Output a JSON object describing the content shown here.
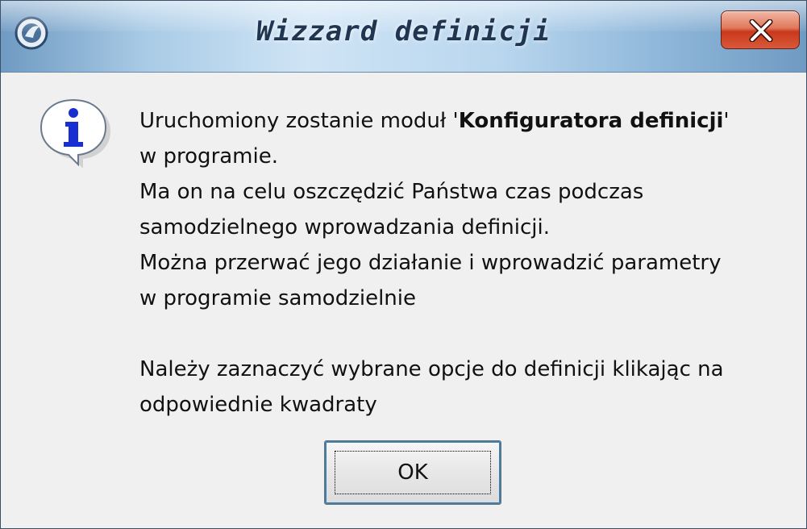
{
  "window": {
    "title": "Wizzard definicji",
    "close_icon": "close-icon",
    "app_icon": "app-icon"
  },
  "message": {
    "icon": "info-icon",
    "line1_prefix": "Uruchomiony zostanie moduł '",
    "line1_bold": "Konfiguratora definicji",
    "line1_suffix": "'",
    "lines": [
      "w programie.",
      "Ma on na celu oszczędzić Państwa czas podczas",
      "samodzielnego wprowadzania definicji.",
      "Można przerwać jego działanie i wprowadzić parametry",
      "w programie samodzielnie"
    ],
    "lines2": [
      "Należy zaznaczyć wybrane opcje do definicji klikając na",
      "odpowiednie kwadraty"
    ]
  },
  "buttons": {
    "ok_label": "OK"
  },
  "colors": {
    "close_button": "#c9381b",
    "info_icon": "#1a2fd1",
    "dialog_bg": "#f0f0f0"
  }
}
